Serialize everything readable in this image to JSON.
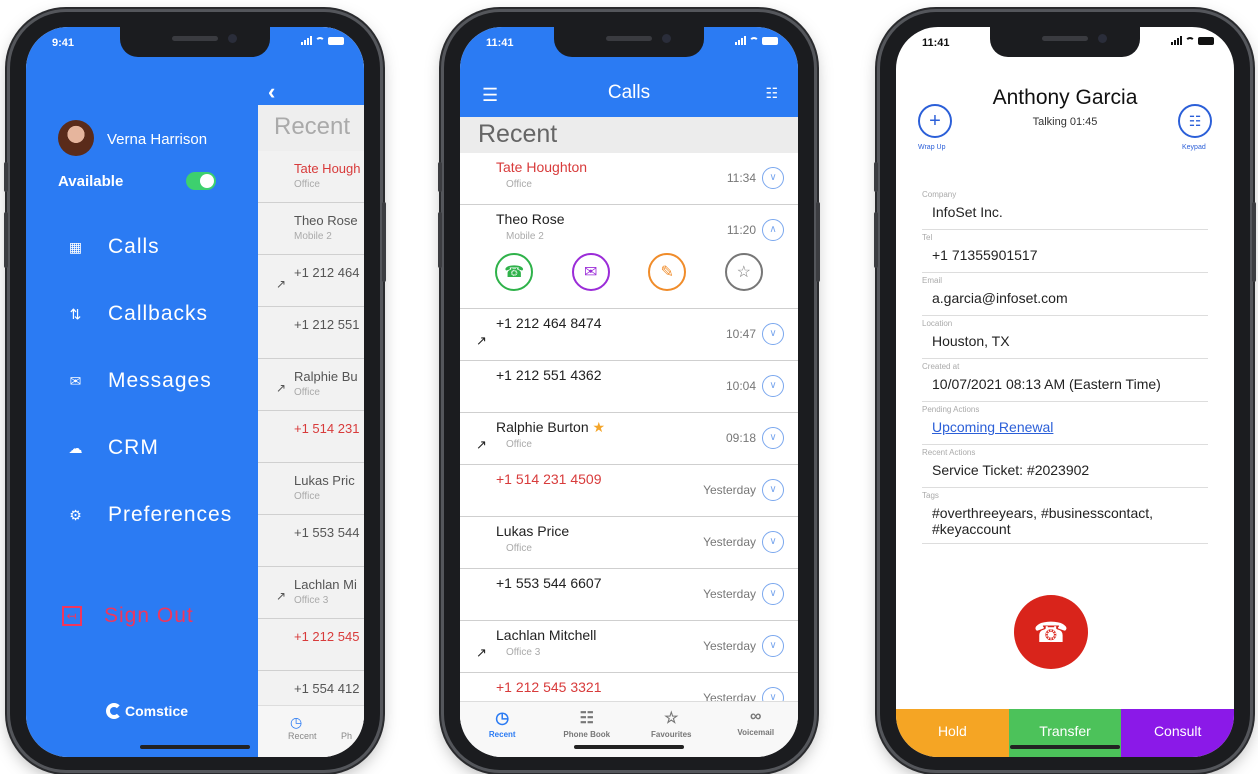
{
  "colors": {
    "brand_blue": "#2b7bf3",
    "missed_red": "#d83b3b",
    "hangup_red": "#d9241b",
    "hold": "#f5a524",
    "transfer": "#4cc25a",
    "consult": "#8b19e8"
  },
  "phone1": {
    "time": "9:41",
    "user_name": "Verna Harrison",
    "availability_label": "Available",
    "menu": [
      {
        "label": "Calls",
        "icon": "calls-icon"
      },
      {
        "label": "Callbacks",
        "icon": "callbacks-icon"
      },
      {
        "label": "Messages",
        "icon": "messages-icon"
      },
      {
        "label": "CRM",
        "icon": "crm-icon"
      },
      {
        "label": "Preferences",
        "icon": "preferences-icon"
      }
    ],
    "sign_out": "Sign Out",
    "logo": "Comstice",
    "under": {
      "recent": "Recent",
      "rows": [
        {
          "name": "Tate Hough",
          "sub": "Office",
          "red": true
        },
        {
          "name": "Theo Rose",
          "sub": "Mobile 2"
        },
        {
          "name": "+1 212 464",
          "sub": ""
        },
        {
          "name": "+1 212 551",
          "sub": ""
        },
        {
          "name": "Ralphie Bu",
          "sub": "Office"
        },
        {
          "name": "+1 514 231",
          "sub": "",
          "red": true
        },
        {
          "name": "Lukas Pric",
          "sub": "Office"
        },
        {
          "name": "+1 553 544",
          "sub": ""
        },
        {
          "name": "Lachlan Mi",
          "sub": "Office 3"
        },
        {
          "name": "+1 212 545",
          "sub": "",
          "red": true
        },
        {
          "name": "+1 554 412",
          "sub": ""
        }
      ],
      "tab_recent": "Recent",
      "tab_partial": "Ph"
    }
  },
  "phone2": {
    "time": "11:41",
    "title": "Calls",
    "recent": "Recent",
    "rows": [
      {
        "name": "Tate Houghton",
        "sub": "Office",
        "time": "11:34",
        "red": true
      },
      {
        "name": "Theo Rose",
        "sub": "Mobile 2",
        "time": "11:20",
        "expanded": true
      },
      {
        "name": "+1 212 464 8474",
        "sub": "",
        "time": "10:47",
        "outgoing": true
      },
      {
        "name": "+1 212 551 4362",
        "sub": "",
        "time": "10:04"
      },
      {
        "name": "Ralphie Burton",
        "sub": "Office",
        "time": "09:18",
        "outgoing": true,
        "star": true
      },
      {
        "name": "+1 514 231 4509",
        "sub": "",
        "time": "Yesterday",
        "red": true
      },
      {
        "name": "Lukas Price",
        "sub": "Office",
        "time": "Yesterday"
      },
      {
        "name": "+1 553 544 6607",
        "sub": "",
        "time": "Yesterday"
      },
      {
        "name": "Lachlan Mitchell",
        "sub": "Office 3",
        "time": "Yesterday",
        "outgoing": true
      },
      {
        "name": "+1 212 545 3321",
        "sub": "",
        "time": "Yesterday",
        "red": true
      }
    ],
    "tabs": [
      {
        "label": "Recent",
        "icon": "clock-icon",
        "active": true
      },
      {
        "label": "Phone Book",
        "icon": "book-icon"
      },
      {
        "label": "Favourites",
        "icon": "star-icon"
      },
      {
        "label": "Voicemail",
        "icon": "voicemail-icon"
      }
    ]
  },
  "phone3": {
    "time": "11:41",
    "contact_name": "Anthony Garcia",
    "call_status": "Talking 01:45",
    "wrap_up": "Wrap Up",
    "keypad": "Keypad",
    "fields": [
      {
        "label": "Company",
        "value": "InfoSet Inc."
      },
      {
        "label": "Tel",
        "value": "+1 71355901517"
      },
      {
        "label": "Email",
        "value": "a.garcia@infoset.com"
      },
      {
        "label": "Location",
        "value": "Houston, TX"
      },
      {
        "label": "Created at",
        "value": "10/07/2021 08:13 AM   (Eastern Time)"
      },
      {
        "label": "Pending Actions",
        "value": "Upcoming Renewal",
        "link": true
      },
      {
        "label": "Recent Actions",
        "value": "Service Ticket: #2023902"
      },
      {
        "label": "Tags",
        "value": "#overthreeyears, #businesscontact, #keyaccount"
      }
    ],
    "actions": [
      "Hold",
      "Transfer",
      "Consult"
    ]
  }
}
